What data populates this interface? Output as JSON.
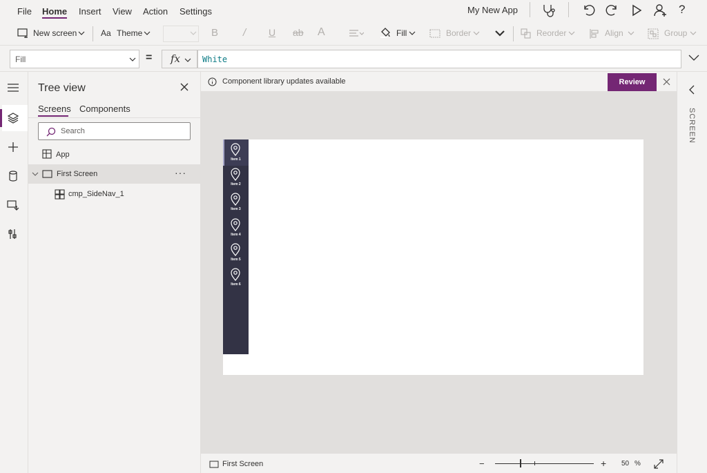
{
  "menu": {
    "items": [
      "File",
      "Home",
      "Insert",
      "View",
      "Action",
      "Settings"
    ],
    "active": "Home"
  },
  "app_name": "My New App",
  "toolbar_icons": [
    "stethoscope-icon",
    "undo-icon",
    "redo-icon",
    "play-icon",
    "share-icon",
    "help-icon"
  ],
  "ribbon": {
    "new_screen": "New screen",
    "theme": "Theme",
    "fill": "Fill",
    "border": "Border",
    "reorder": "Reorder",
    "align": "Align",
    "group": "Group"
  },
  "formula": {
    "property": "Fill",
    "equals": "=",
    "fx": "fx",
    "value": "White"
  },
  "tree": {
    "title": "Tree view",
    "tabs": [
      "Screens",
      "Components"
    ],
    "search_placeholder": "Search",
    "items": [
      {
        "label": "App",
        "icon": "app-icon"
      },
      {
        "label": "First Screen",
        "icon": "screen-icon",
        "selected": true,
        "more": "···"
      },
      {
        "label": "cmp_SideNav_1",
        "icon": "component-icon"
      }
    ]
  },
  "notification": {
    "text": "Component library updates available",
    "button": "Review"
  },
  "sidenav": {
    "items": [
      "Item 1",
      "Item 2",
      "Item 3",
      "Item 4",
      "Item 5",
      "Item 6"
    ]
  },
  "status": {
    "screen": "First Screen",
    "zoom": "50",
    "zoom_unit": "%"
  },
  "right_panel": {
    "label": "SCREEN"
  },
  "colors": {
    "accent": "#742774",
    "sidenav_bg": "#333345",
    "formula_text": "#0e7c86"
  }
}
